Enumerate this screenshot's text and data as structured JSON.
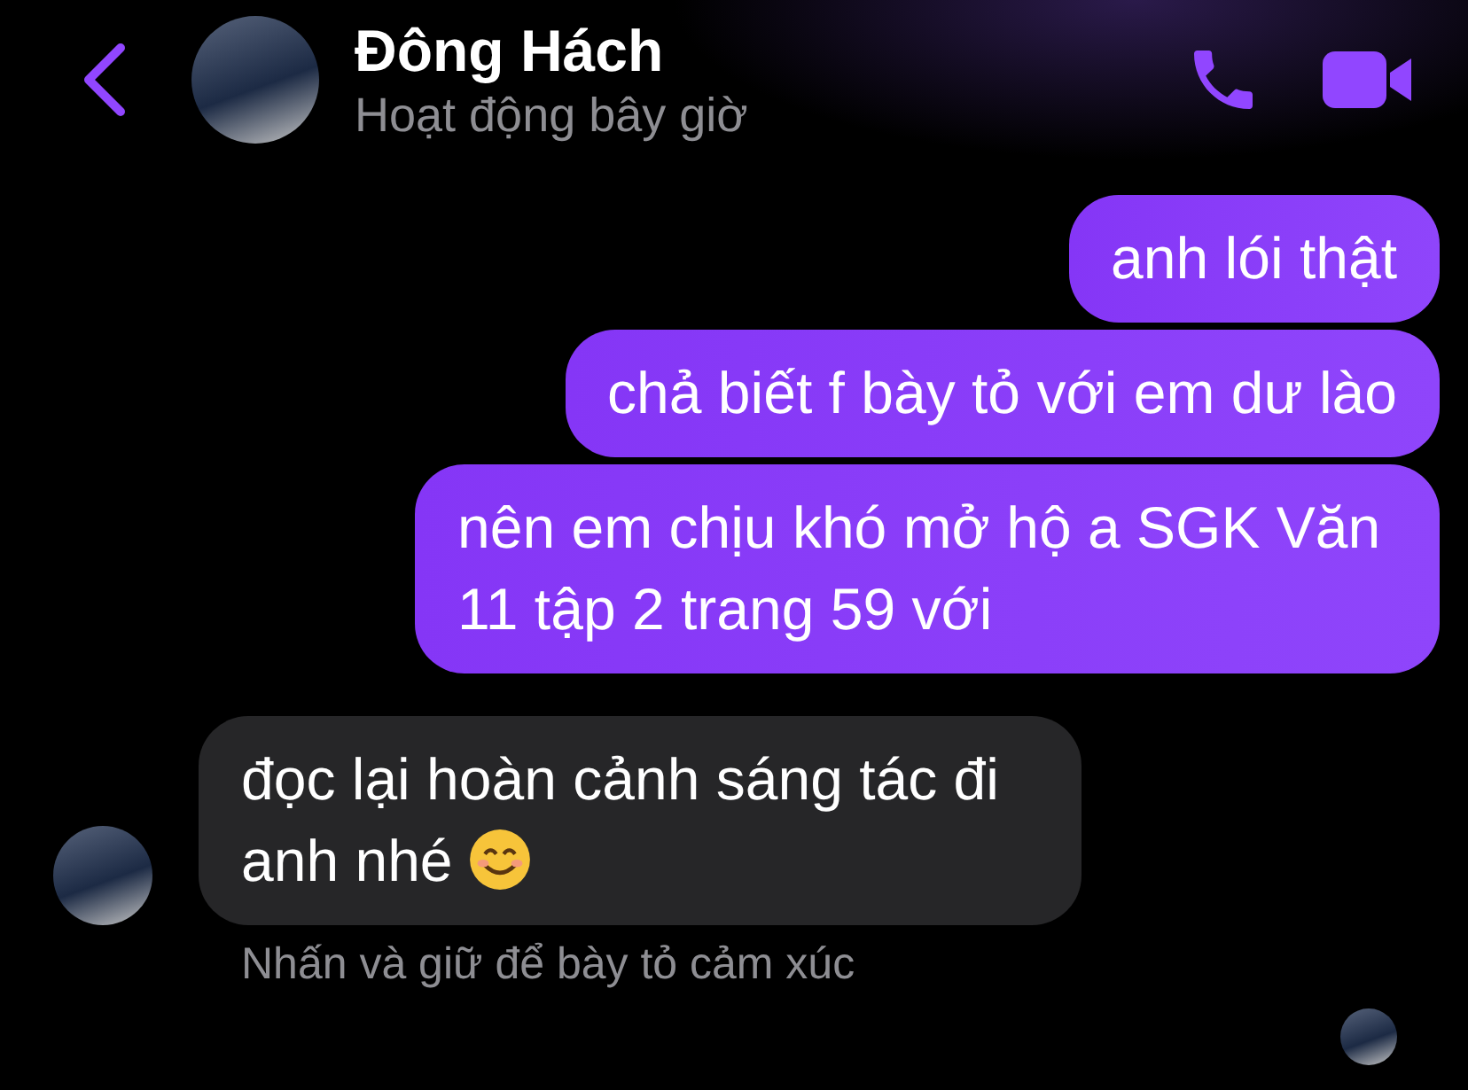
{
  "header": {
    "name": "Đông Hách",
    "status": "Hoạt động bây giờ"
  },
  "messages": [
    {
      "kind": "sent",
      "text": "anh lói thật"
    },
    {
      "kind": "sent",
      "text": "chả biết f bày tỏ với em dư lào"
    },
    {
      "kind": "sent",
      "text": "nên em chịu khó mở hộ a SGK Văn 11 tập 2 trang 59 với"
    },
    {
      "kind": "received",
      "text": "đọc lại hoàn cảnh sáng tác đi anh nhé",
      "smiley": true
    }
  ],
  "hint": "Nhấn và giữ để bày tỏ cảm xúc"
}
